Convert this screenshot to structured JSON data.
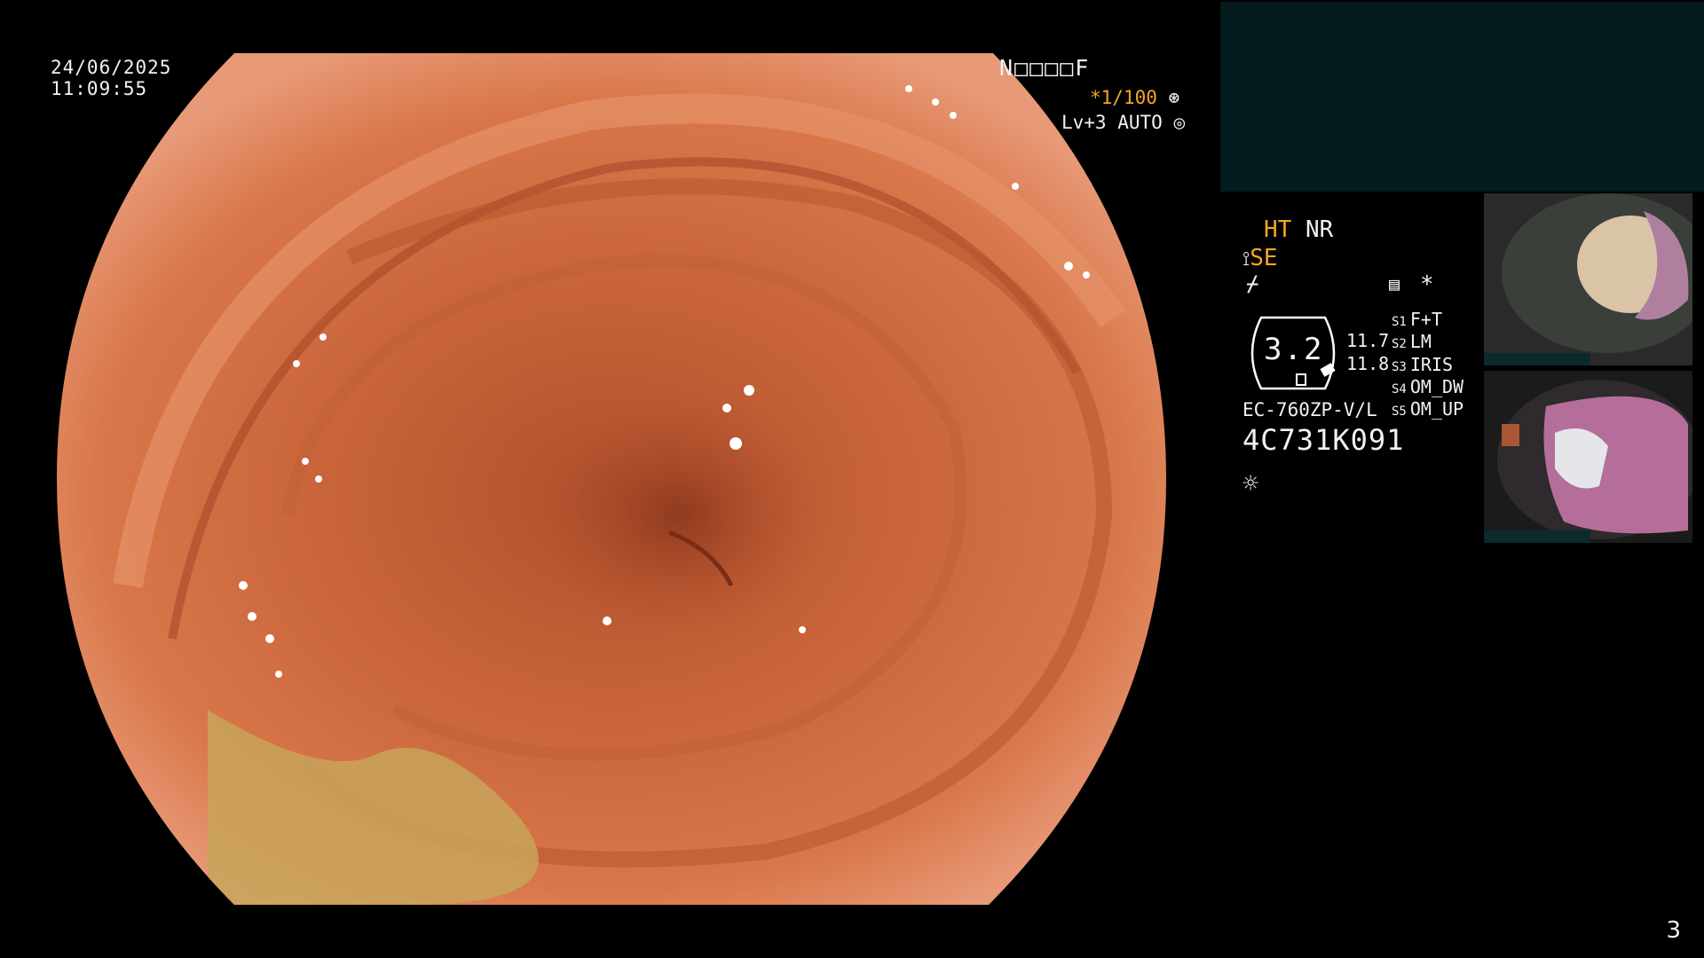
{
  "overlay": {
    "date": "24/06/2025",
    "time": "11:09:55",
    "patient_code": "N□□□□F",
    "shutter": "*1/100",
    "level": "Lv+3 AUTO"
  },
  "panel": {
    "ht": "HT",
    "nr": "NR",
    "se": "SE",
    "gauge_value": "3.2",
    "side_values": [
      "11.7",
      "11.8"
    ],
    "slots": [
      {
        "key": "S1",
        "value": "F+T"
      },
      {
        "key": "S2",
        "value": "LM"
      },
      {
        "key": "S3",
        "value": "IRIS"
      },
      {
        "key": "S4",
        "value": "OM_DW"
      },
      {
        "key": "S5",
        "value": "OM_UP"
      }
    ],
    "model": "EC-760ZP-V/L",
    "serial": "4C731K091",
    "asterisk": "*"
  },
  "page_number": "3",
  "colors": {
    "accent_orange": "#f5a623",
    "panel_teal": "#051c1f",
    "mucosa": "#c85a34"
  },
  "icons": [
    "aperture-icon",
    "auto-iris-icon",
    "scope-icon",
    "freeze-icon",
    "memo-icon",
    "light-icon"
  ]
}
